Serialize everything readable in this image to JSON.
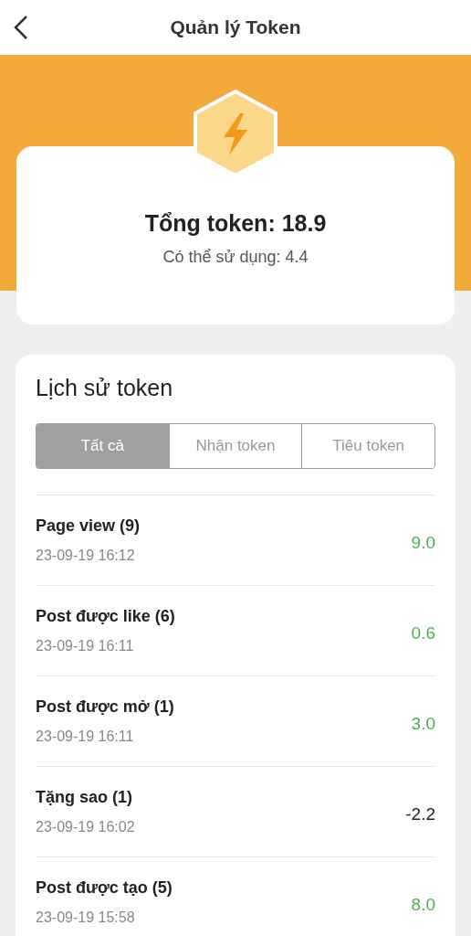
{
  "header": {
    "title": "Quản lý Token"
  },
  "summary": {
    "total": "Tổng token: 18.9",
    "available": "Có thể sử dụng: 4.4"
  },
  "history": {
    "title": "Lịch sử token",
    "tabs": [
      {
        "label": "Tất cả",
        "selected": true
      },
      {
        "label": "Nhận token",
        "selected": false
      },
      {
        "label": "Tiêu token",
        "selected": false
      }
    ],
    "rows": [
      {
        "name": "Page view (9)",
        "time": "23-09-19 16:12",
        "amount": "9.0",
        "kind": "credit"
      },
      {
        "name": "Post được like (6)",
        "time": "23-09-19 16:11",
        "amount": "0.6",
        "kind": "credit"
      },
      {
        "name": "Post được mở (1)",
        "time": "23-09-19 16:11",
        "amount": "3.0",
        "kind": "credit"
      },
      {
        "name": "Tặng sao (1)",
        "time": "23-09-19 16:02",
        "amount": "-2.2",
        "kind": "debit"
      },
      {
        "name": "Post được tạo (5)",
        "time": "23-09-19 15:58",
        "amount": "8.0",
        "kind": "credit"
      }
    ]
  }
}
